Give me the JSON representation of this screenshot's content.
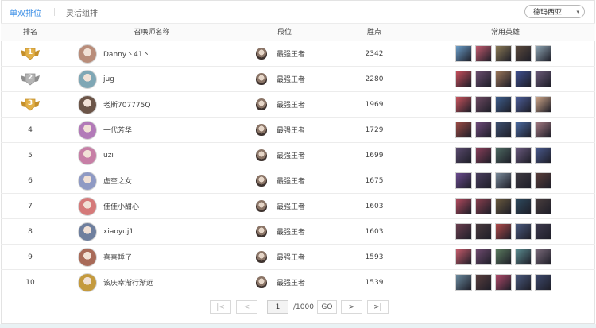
{
  "tabs": [
    {
      "label": "单双排位",
      "active": true
    },
    {
      "label": "灵活组排",
      "active": false
    }
  ],
  "region": {
    "label": "德玛西亚",
    "arrow": "▾"
  },
  "columns": {
    "rank": "排名",
    "summoner": "召唤师名称",
    "tier": "段位",
    "points": "胜点",
    "heroes": "常用英雄"
  },
  "medal_colors": {
    "gold": "#e2b048",
    "silver": "#b5b5b5",
    "gold_dark": "#c48f2a",
    "silver_dark": "#8e8e8e"
  },
  "rows": [
    {
      "rank": "1",
      "medal": "gold",
      "name": "Danny丶41丶",
      "tier": "最强王者",
      "points": "2342",
      "avatar_color": "#b98d7a",
      "heroes": [
        "#6a9cc7",
        "#c25a6e",
        "#8b7a55",
        "#5b4a3d",
        "#8fa6b4"
      ]
    },
    {
      "rank": "2",
      "medal": "silver",
      "name": "jug",
      "tier": "最强王者",
      "points": "2280",
      "avatar_color": "#7fa7b5",
      "heroes": [
        "#c44d5a",
        "#6a4d6e",
        "#9a7658",
        "#3e4f8f",
        "#6b5a78"
      ]
    },
    {
      "rank": "3",
      "medal": "gold",
      "name": "老斯707775Q",
      "tier": "最强王者",
      "points": "1969",
      "avatar_color": "#6c5548",
      "heroes": [
        "#c9535d",
        "#6d4a62",
        "#3f5f8e",
        "#4d5f9a",
        "#d1a88a"
      ]
    },
    {
      "rank": "4",
      "medal": "",
      "name": "一代芳华",
      "tier": "最强王者",
      "points": "1729",
      "avatar_color": "#b27ab8",
      "heroes": [
        "#9a4a44",
        "#6e4a7a",
        "#3d5070",
        "#4a6aa0",
        "#a47a82"
      ]
    },
    {
      "rank": "5",
      "medal": "",
      "name": "uzi",
      "tier": "最强王者",
      "points": "1699",
      "avatar_color": "#c77fa6",
      "heroes": [
        "#5a4a6e",
        "#8a3f5a",
        "#4e6a62",
        "#6a5a7e",
        "#4a5a8e"
      ]
    },
    {
      "rank": "6",
      "medal": "",
      "name": "虚空之女",
      "tier": "最强王者",
      "points": "1675",
      "avatar_color": "#8f9ac4",
      "heroes": [
        "#6a4a8e",
        "#4a3e5e",
        "#7a8a9a",
        "#3e3a42",
        "#5a3e3a"
      ]
    },
    {
      "rank": "7",
      "medal": "",
      "name": "佳佳小甜心",
      "tier": "最强王者",
      "points": "1603",
      "avatar_color": "#d57a7a",
      "heroes": [
        "#b34a5e",
        "#8a3f4e",
        "#6a5a3e",
        "#2e4a5e",
        "#4a3e3e"
      ]
    },
    {
      "rank": "8",
      "medal": "",
      "name": "xiaoyuj1",
      "tier": "最强王者",
      "points": "1603",
      "avatar_color": "#6e7f9e",
      "heroes": [
        "#6a3e4e",
        "#4a3a3e",
        "#b04a4a",
        "#4a5a7e",
        "#3e3a4e"
      ]
    },
    {
      "rank": "9",
      "medal": "",
      "name": "喜喜睡了",
      "tier": "最强王者",
      "points": "1593",
      "avatar_color": "#a86a58",
      "heroes": [
        "#c45a6a",
        "#6e4a6e",
        "#5a7a5e",
        "#5a8a8e",
        "#7a6a7a"
      ]
    },
    {
      "rank": "10",
      "medal": "",
      "name": "该庆幸渐行渐远",
      "tier": "最强王者",
      "points": "1539",
      "avatar_color": "#c49a3e",
      "heroes": [
        "#6a8a9e",
        "#5a3e3e",
        "#b04a6a",
        "#4a5a7e",
        "#3e4a6e"
      ]
    }
  ],
  "pager": {
    "first": "|<",
    "prev": "<",
    "page": "1",
    "total": "/1000",
    "go": "GO",
    "next": ">",
    "last": ">|"
  }
}
